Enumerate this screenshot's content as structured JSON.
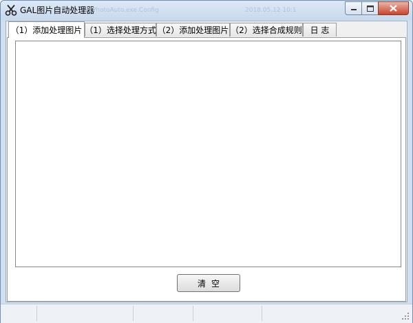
{
  "window": {
    "title": "GAL图片自动处理器",
    "background_ghost_texts": [
      "ixPhotoAuto.exe.Config",
      "2018.05.12 10:1"
    ]
  },
  "tabs": [
    {
      "label": "（1）添加处理图片",
      "active": true
    },
    {
      "label": "（1）选择处理方式",
      "active": false
    },
    {
      "label": "（2）添加处理图片",
      "active": false
    },
    {
      "label": "（2）选择合成规则",
      "active": false
    },
    {
      "label": "日 志",
      "active": false
    }
  ],
  "main": {
    "image_list": [],
    "clear_button_label": "清空"
  },
  "statusbar": {
    "cells": [
      "",
      "",
      "",
      ""
    ]
  },
  "icons": {
    "app": "scissors-icon",
    "minimize": "minimize-icon",
    "maximize": "maximize-icon",
    "close": "close-icon",
    "resize": "resize-grip-icon"
  },
  "colors": {
    "frame": "#cfdff0",
    "close_button": "#c9452c",
    "client_bg": "#f0f0f0"
  }
}
